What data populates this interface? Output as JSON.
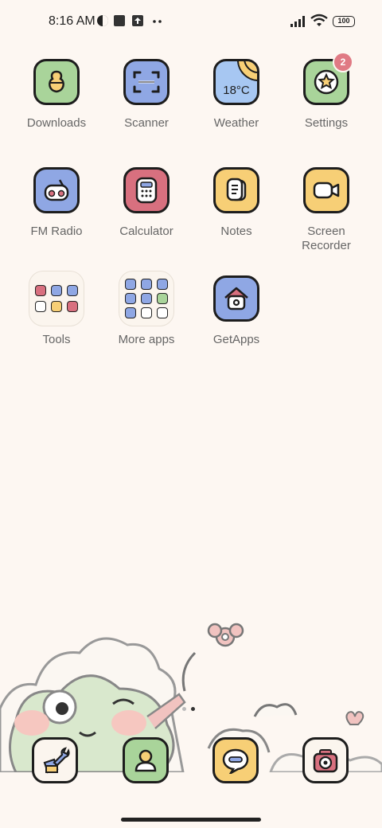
{
  "status_bar": {
    "time": "8:16 AM",
    "battery": "100",
    "icons": [
      "theme-icon",
      "square-notification-icon",
      "upload-notification-icon",
      "more-dots-icon",
      "signal-icon",
      "wifi-icon",
      "battery-icon"
    ]
  },
  "apps": [
    {
      "label": "Downloads",
      "color": "#a9d49a",
      "icon": "download-icon"
    },
    {
      "label": "Scanner",
      "color": "#8fa7e4",
      "icon": "scan-icon"
    },
    {
      "label": "Weather",
      "color": "#a7c7f2",
      "icon": "weather-icon",
      "temp": "18°C"
    },
    {
      "label": "Settings",
      "color": "#a9d49a",
      "icon": "settings-icon",
      "badge": "2"
    },
    {
      "label": "FM Radio",
      "color": "#8fa7e4",
      "icon": "radio-icon"
    },
    {
      "label": "Calculator",
      "color": "#d8707f",
      "icon": "calculator-icon"
    },
    {
      "label": "Notes",
      "color": "#f7cf76",
      "icon": "notes-icon"
    },
    {
      "label": "Screen\nRecorder",
      "color": "#f7cf76",
      "icon": "video-icon"
    },
    {
      "label": "Tools",
      "icon": "folder-icon"
    },
    {
      "label": "More apps",
      "icon": "folder-icon"
    },
    {
      "label": "GetApps",
      "color": "#8fa7e4",
      "icon": "store-icon"
    }
  ],
  "dock": [
    {
      "name": "tools",
      "color": "#fbf5ee",
      "icon": "wrench-icon"
    },
    {
      "name": "contacts",
      "color": "#a9d49a",
      "icon": "person-icon"
    },
    {
      "name": "messages",
      "color": "#f7cf76",
      "icon": "chat-icon"
    },
    {
      "name": "camera",
      "color": "#fbf5ee",
      "icon": "camera-icon"
    }
  ]
}
